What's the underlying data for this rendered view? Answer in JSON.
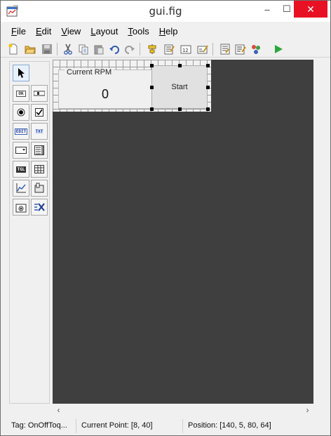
{
  "window": {
    "title": "gui.fig"
  },
  "title_buttons": {
    "minimize": "–",
    "maximize": "☐",
    "close": "✕"
  },
  "menu": [
    "File",
    "Edit",
    "View",
    "Layout",
    "Tools",
    "Help"
  ],
  "toolbar": [
    "new-file-icon",
    "open-folder-icon",
    "save-icon",
    "cut-icon",
    "copy-icon",
    "paste-icon",
    "undo-icon",
    "redo-icon",
    "align-objects-icon",
    "menu-editor-icon",
    "tab-order-editor-icon",
    "toolbar-editor-icon",
    "m-file-editor-icon",
    "property-inspector-icon",
    "object-browser-icon",
    "run-figure-icon"
  ],
  "palette": {
    "select_tool": "arrow-select-icon",
    "items": [
      {
        "id": "push-button",
        "label": "OK"
      },
      {
        "id": "slider",
        "label": ""
      },
      {
        "id": "radio-button",
        "label": ""
      },
      {
        "id": "check-box",
        "label": ""
      },
      {
        "id": "edit-text",
        "label": "EDIT"
      },
      {
        "id": "static-text",
        "label": "TXT"
      },
      {
        "id": "pop-up-menu",
        "label": ""
      },
      {
        "id": "listbox",
        "label": ""
      },
      {
        "id": "toggle-button",
        "label": "TGL"
      },
      {
        "id": "table",
        "label": ""
      },
      {
        "id": "axes",
        "label": ""
      },
      {
        "id": "panel",
        "label": ""
      },
      {
        "id": "button-group",
        "label": ""
      },
      {
        "id": "activex-control",
        "label": ""
      }
    ]
  },
  "canvas": {
    "panel_title": "Current RPM",
    "panel_value": "0",
    "button_label": "Start",
    "background_color": "#3f3f3f"
  },
  "scroll": {
    "left": "‹",
    "right": "›"
  },
  "status": {
    "tag": "Tag: OnOffToq...",
    "current_point": "Current Point:  [8, 40]",
    "position": "Position: [140, 5, 80, 64]"
  }
}
